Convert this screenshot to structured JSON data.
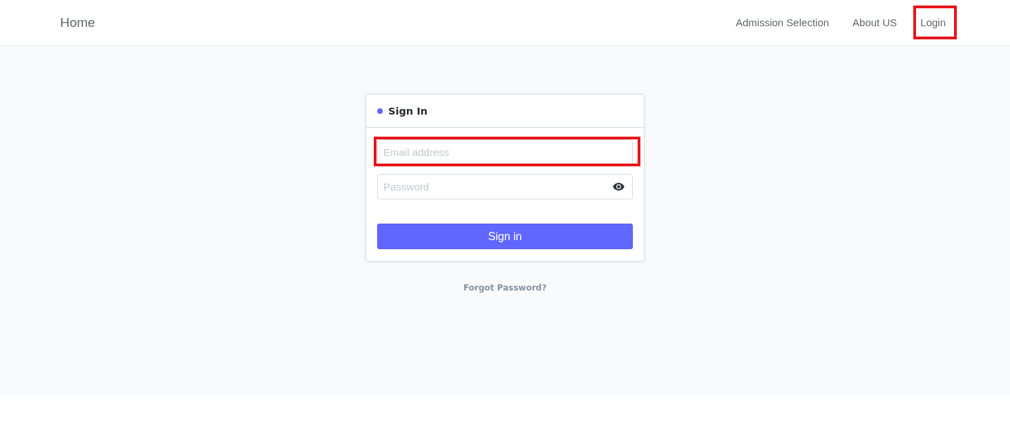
{
  "navbar": {
    "brand": "Home",
    "links": [
      {
        "label": "Admission Selection",
        "highlighted": false
      },
      {
        "label": "About US",
        "highlighted": false
      },
      {
        "label": "Login",
        "highlighted": true
      }
    ]
  },
  "form": {
    "title": "Sign In",
    "fields": [
      {
        "kind": "email",
        "placeholder": "Email address",
        "highlighted": true
      },
      {
        "kind": "password",
        "placeholder": "Password",
        "highlighted": false
      }
    ],
    "submit": "Sign in"
  },
  "forgot_link": "Forgot Password?"
}
